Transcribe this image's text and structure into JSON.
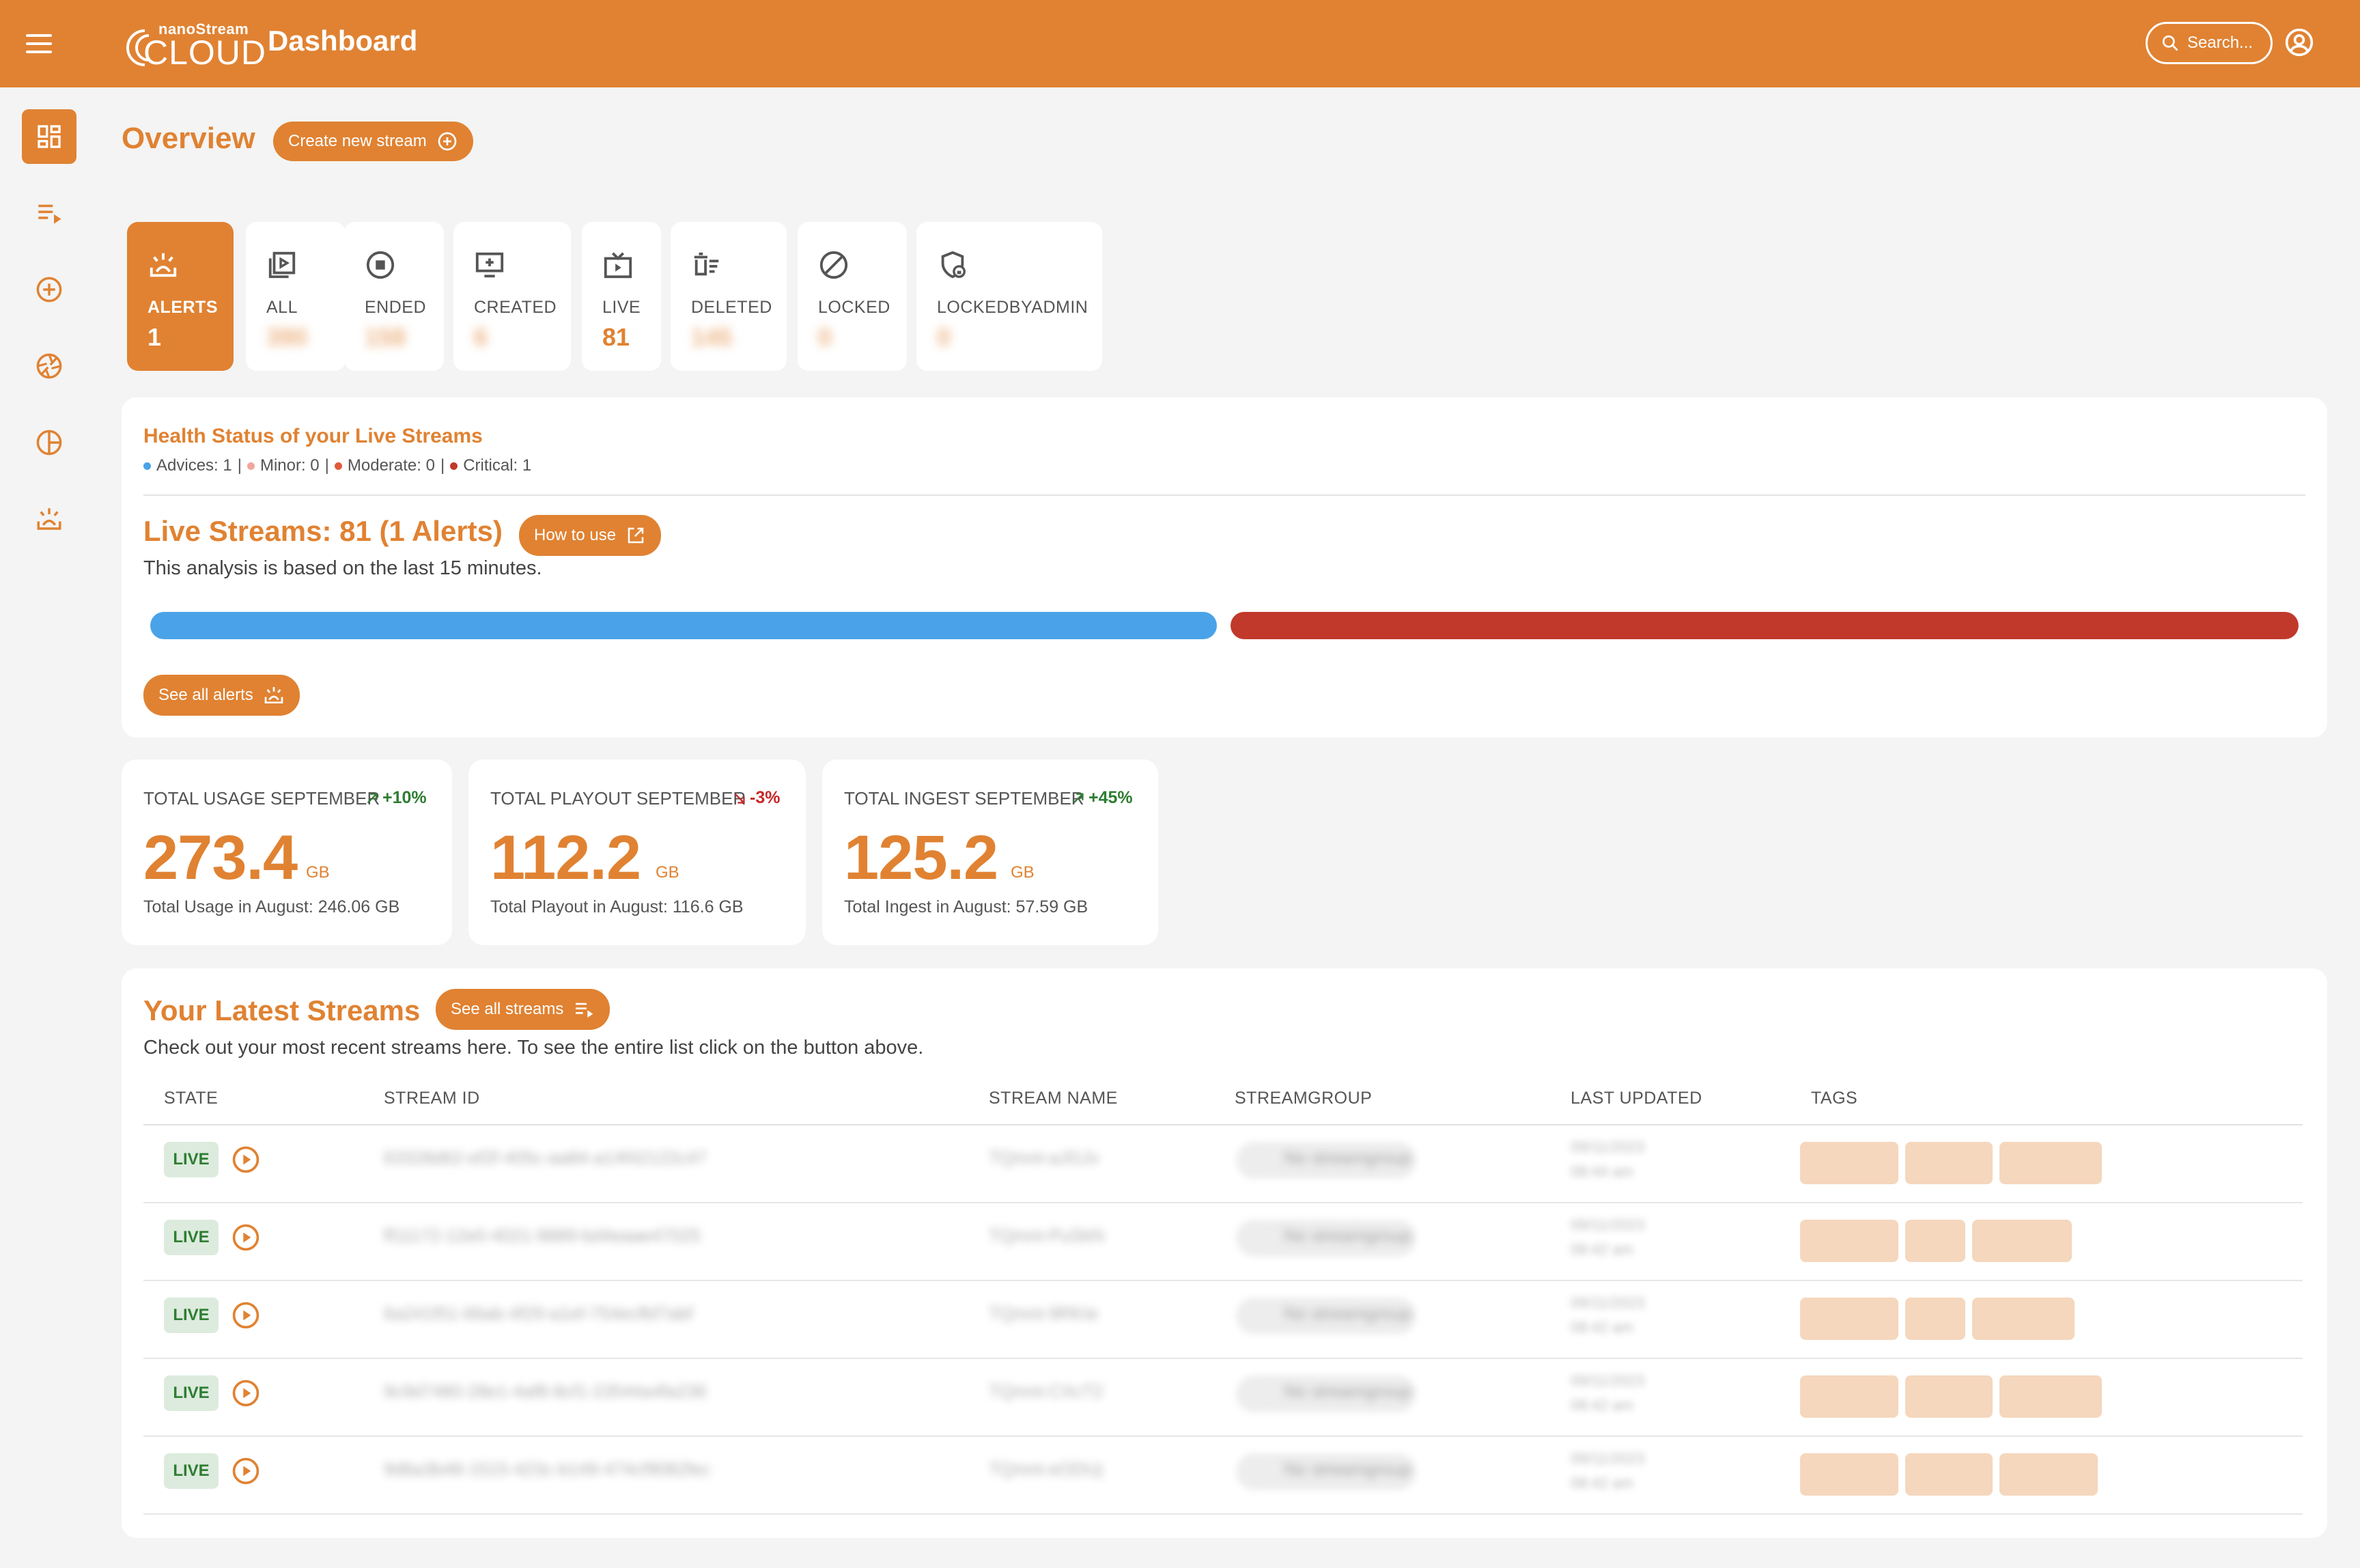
{
  "header": {
    "brand_small": "nanoStream",
    "brand_big": "CLOUD",
    "title": "Dashboard",
    "search_label": "Search..."
  },
  "sidebar": {
    "items": [
      {
        "name": "dashboard",
        "active": true
      },
      {
        "name": "streams"
      },
      {
        "name": "create"
      },
      {
        "name": "analytics"
      },
      {
        "name": "usage"
      },
      {
        "name": "alerts"
      }
    ]
  },
  "overview": {
    "title": "Overview",
    "create_button": "Create new stream"
  },
  "tiles": [
    {
      "label": "ALERTS",
      "value": "1"
    },
    {
      "label": "ALL",
      "value": "390"
    },
    {
      "label": "ENDED",
      "value": "158"
    },
    {
      "label": "CREATED",
      "value": "6"
    },
    {
      "label": "LIVE",
      "value": "81"
    },
    {
      "label": "DELETED",
      "value": "145"
    },
    {
      "label": "LOCKED",
      "value": "0"
    },
    {
      "label": "LOCKEDBYADMIN",
      "value": "0"
    }
  ],
  "health": {
    "title": "Health Status of your Live Streams",
    "legend": [
      {
        "text": "Advices: 1",
        "color": "#4AA3E8"
      },
      {
        "text": "Minor: 0",
        "color": "#F0A79E"
      },
      {
        "text": "Moderate: 0",
        "color": "#E05A3A"
      },
      {
        "text": "Critical: 1",
        "color": "#C0392B"
      }
    ],
    "live_title": "Live Streams: 81 (1 Alerts)",
    "how_to_use": "How to use",
    "analysis_note": "This analysis is based on the last 15 minutes.",
    "bar_colors": [
      "#4AA3E8",
      "#C0392B"
    ],
    "see_alerts": "See all alerts"
  },
  "stats": [
    {
      "label": "TOTAL USAGE SEPTEMBER",
      "trend": "+10%",
      "trend_dir": "up",
      "value": "273.4",
      "unit": "GB",
      "foot": "Total Usage in August: 246.06 GB"
    },
    {
      "label": "TOTAL PLAYOUT SEPTEMBER",
      "trend": "-3%",
      "trend_dir": "down",
      "value": "112.2",
      "unit": "GB",
      "foot": "Total Playout in August: 116.6 GB"
    },
    {
      "label": "TOTAL INGEST SEPTEMBER",
      "trend": "+45%",
      "trend_dir": "up",
      "value": "125.2",
      "unit": "GB",
      "foot": "Total Ingest in August: 57.59 GB"
    }
  ],
  "latest": {
    "title": "Your Latest Streams",
    "see_all": "See all streams",
    "subtitle": "Check out your most recent streams here. To see the entire list click on the button above.",
    "columns": [
      "STATE",
      "STREAM ID",
      "STREAM NAME",
      "STREAMGROUP",
      "LAST UPDATED",
      "TAGS"
    ],
    "rows": [
      {
        "state": "LIVE",
        "id": "63328d62-ef2f-405c-aa84-a14f42122c47",
        "name": "TQmnt-aJGJv",
        "group": "No streamgroup",
        "date": "09/11/2023",
        "time": "08:44 am"
      },
      {
        "state": "LIVE",
        "id": "ff11172-12e0-4021-9889-bd4eaae47025",
        "name": "TQmnt-PuSkN",
        "group": "No streamgroup",
        "date": "09/11/2023",
        "time": "08:42 am"
      },
      {
        "state": "LIVE",
        "id": "6a241f51-66ab-4f29-a1ef-754ecfbf7abf",
        "name": "TQmnt-9RKIe",
        "group": "No streamgroup",
        "date": "09/11/2023",
        "time": "08:42 am"
      },
      {
        "state": "LIVE",
        "id": "9c9d7480-28e1-4af8-8cf1-23544a4fa236",
        "name": "TQmnt-CXcT2",
        "group": "No streamgroup",
        "date": "09/11/2023",
        "time": "08:42 am"
      },
      {
        "state": "LIVE",
        "id": "9d6a3b48-1515-423c-b149-474cf9082fec",
        "name": "TQmnt-eODUj",
        "group": "No streamgroup",
        "date": "09/11/2023",
        "time": "08:42 am"
      }
    ]
  },
  "colors": {
    "accent": "#E08232",
    "background": "#F4F4F4",
    "live_green": "#2E7D32",
    "trend_down": "#C62828"
  }
}
